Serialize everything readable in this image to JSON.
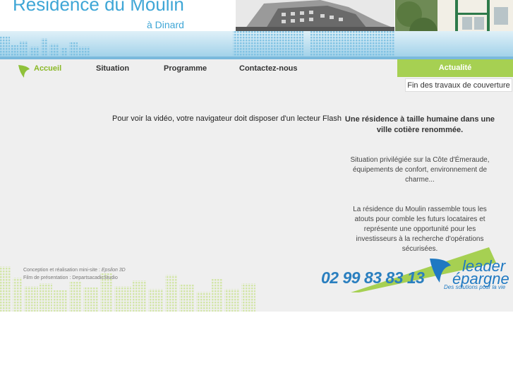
{
  "header": {
    "title": "Résidence du Moulin",
    "subtitle": "à Dinard"
  },
  "nav": {
    "items": [
      {
        "label": "Accueil"
      },
      {
        "label": "Situation"
      },
      {
        "label": "Programme"
      },
      {
        "label": "Contactez-nous"
      }
    ],
    "actualite": {
      "label": "Actualité",
      "item": "Fin des travaux de couverture"
    }
  },
  "main": {
    "flash_notice": "Pour voir la vidéo, votre navigateur doit disposer d'un lecteur Flash",
    "intro_title": "Une résidence à taille humaine dans une ville cotière renommée.",
    "intro_text1": "Situation privilégiée sur la Côte d'Émeraude, équipements de confort, environnement de charme...",
    "intro_text2": "La résidence du Moulin rassemble tous les atouts pour comble les futurs locataires et représente une opportunité pour les investisseurs à la recherche d'opérations sécurisées."
  },
  "footer": {
    "credit1_prefix": "Conception et réalisation mini-site : ",
    "credit1_name": "Epsilon 3D",
    "credit2": "Film de présentation : DepartsacadicStudio",
    "phone": "02 99 83 83 13",
    "brand_line1": "leader",
    "brand_line2": "épargne",
    "tagline": "Des solutions pour la vie"
  },
  "colors": {
    "accent_blue": "#3ea6d6",
    "accent_green": "#a6d052",
    "brand_blue": "#1f79c2"
  }
}
